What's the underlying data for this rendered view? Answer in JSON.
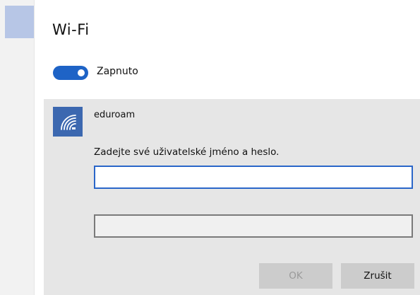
{
  "window": {
    "title": "Wi-Fi"
  },
  "wifi_toggle": {
    "state": "on",
    "label": "Zapnuto",
    "color": "#1e63c6"
  },
  "network": {
    "name": "eduroam",
    "icon": "wifi-signal-icon",
    "icon_color": "#3c68b0"
  },
  "credentials": {
    "prompt": "Zadejte své uživatelské jméno a heslo.",
    "username_value": "",
    "password_value": ""
  },
  "buttons": {
    "ok_label": "OK",
    "ok_enabled": false,
    "cancel_label": "Zrušit"
  }
}
